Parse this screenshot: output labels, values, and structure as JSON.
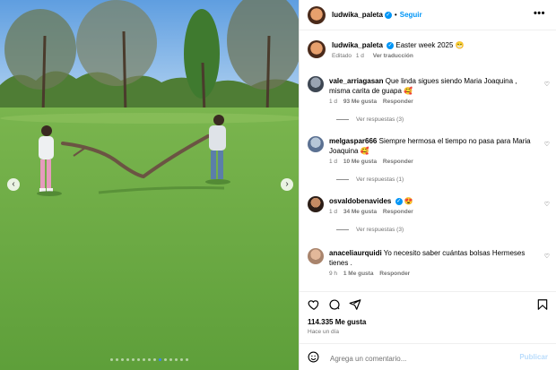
{
  "post": {
    "carousel": {
      "slide_count": 15,
      "active_index": 9
    },
    "author": {
      "username": "ludwika_paleta",
      "verified_mark": "✓"
    },
    "follow_label": "Seguir",
    "more_label": "•••",
    "caption": {
      "text": "Easter week 2025",
      "emoji": "😁",
      "edited_label": "Editado",
      "age": "1 d",
      "translate_label": "Ver traducción"
    },
    "comments": [
      {
        "username": "vale_arriagasan",
        "verified": false,
        "text": "Que linda sigues siendo Maria Joaquina , misma carita de guapa",
        "emoji": "🥰",
        "age": "1 d",
        "likes": "93 Me gusta",
        "reply_label": "Responder",
        "view_replies": "Ver respuestas (3)"
      },
      {
        "username": "melgaspar666",
        "verified": false,
        "text": "Siempre hermosa el tiempo no pasa para Maria Joaquina",
        "emoji": "🥰",
        "age": "1 d",
        "likes": "10 Me gusta",
        "reply_label": "Responder",
        "view_replies": "Ver respuestas (1)"
      },
      {
        "username": "osvaldobenavides",
        "verified": true,
        "text": "",
        "emoji": "😍",
        "age": "1 d",
        "likes": "34 Me gusta",
        "reply_label": "Responder",
        "view_replies": "Ver respuestas (3)"
      },
      {
        "username": "anaceliaurquidi",
        "verified": false,
        "text": "Yo necesito saber cuántas bolsas Hermeses tienes .",
        "emoji": "",
        "age": "9 h",
        "likes": "1 Me gusta",
        "reply_label": "Responder",
        "view_replies": ""
      }
    ],
    "likes_label": "114.335 Me gusta",
    "posted_label": "Hace un día",
    "composer": {
      "placeholder": "Agrega un comentario...",
      "publish_label": "Publicar"
    },
    "icons": [
      "heart-icon",
      "comment-icon",
      "share-icon",
      "bookmark-icon",
      "emoji-icon",
      "chevron-left-icon",
      "chevron-right-icon",
      "verified-icon",
      "more-icon"
    ],
    "colors": {
      "accent": "#0095f6",
      "muted": "#737373",
      "publish_disabled": "#b9dcfc",
      "grass": "#6aa845",
      "sky": "#7fb6ea"
    }
  }
}
